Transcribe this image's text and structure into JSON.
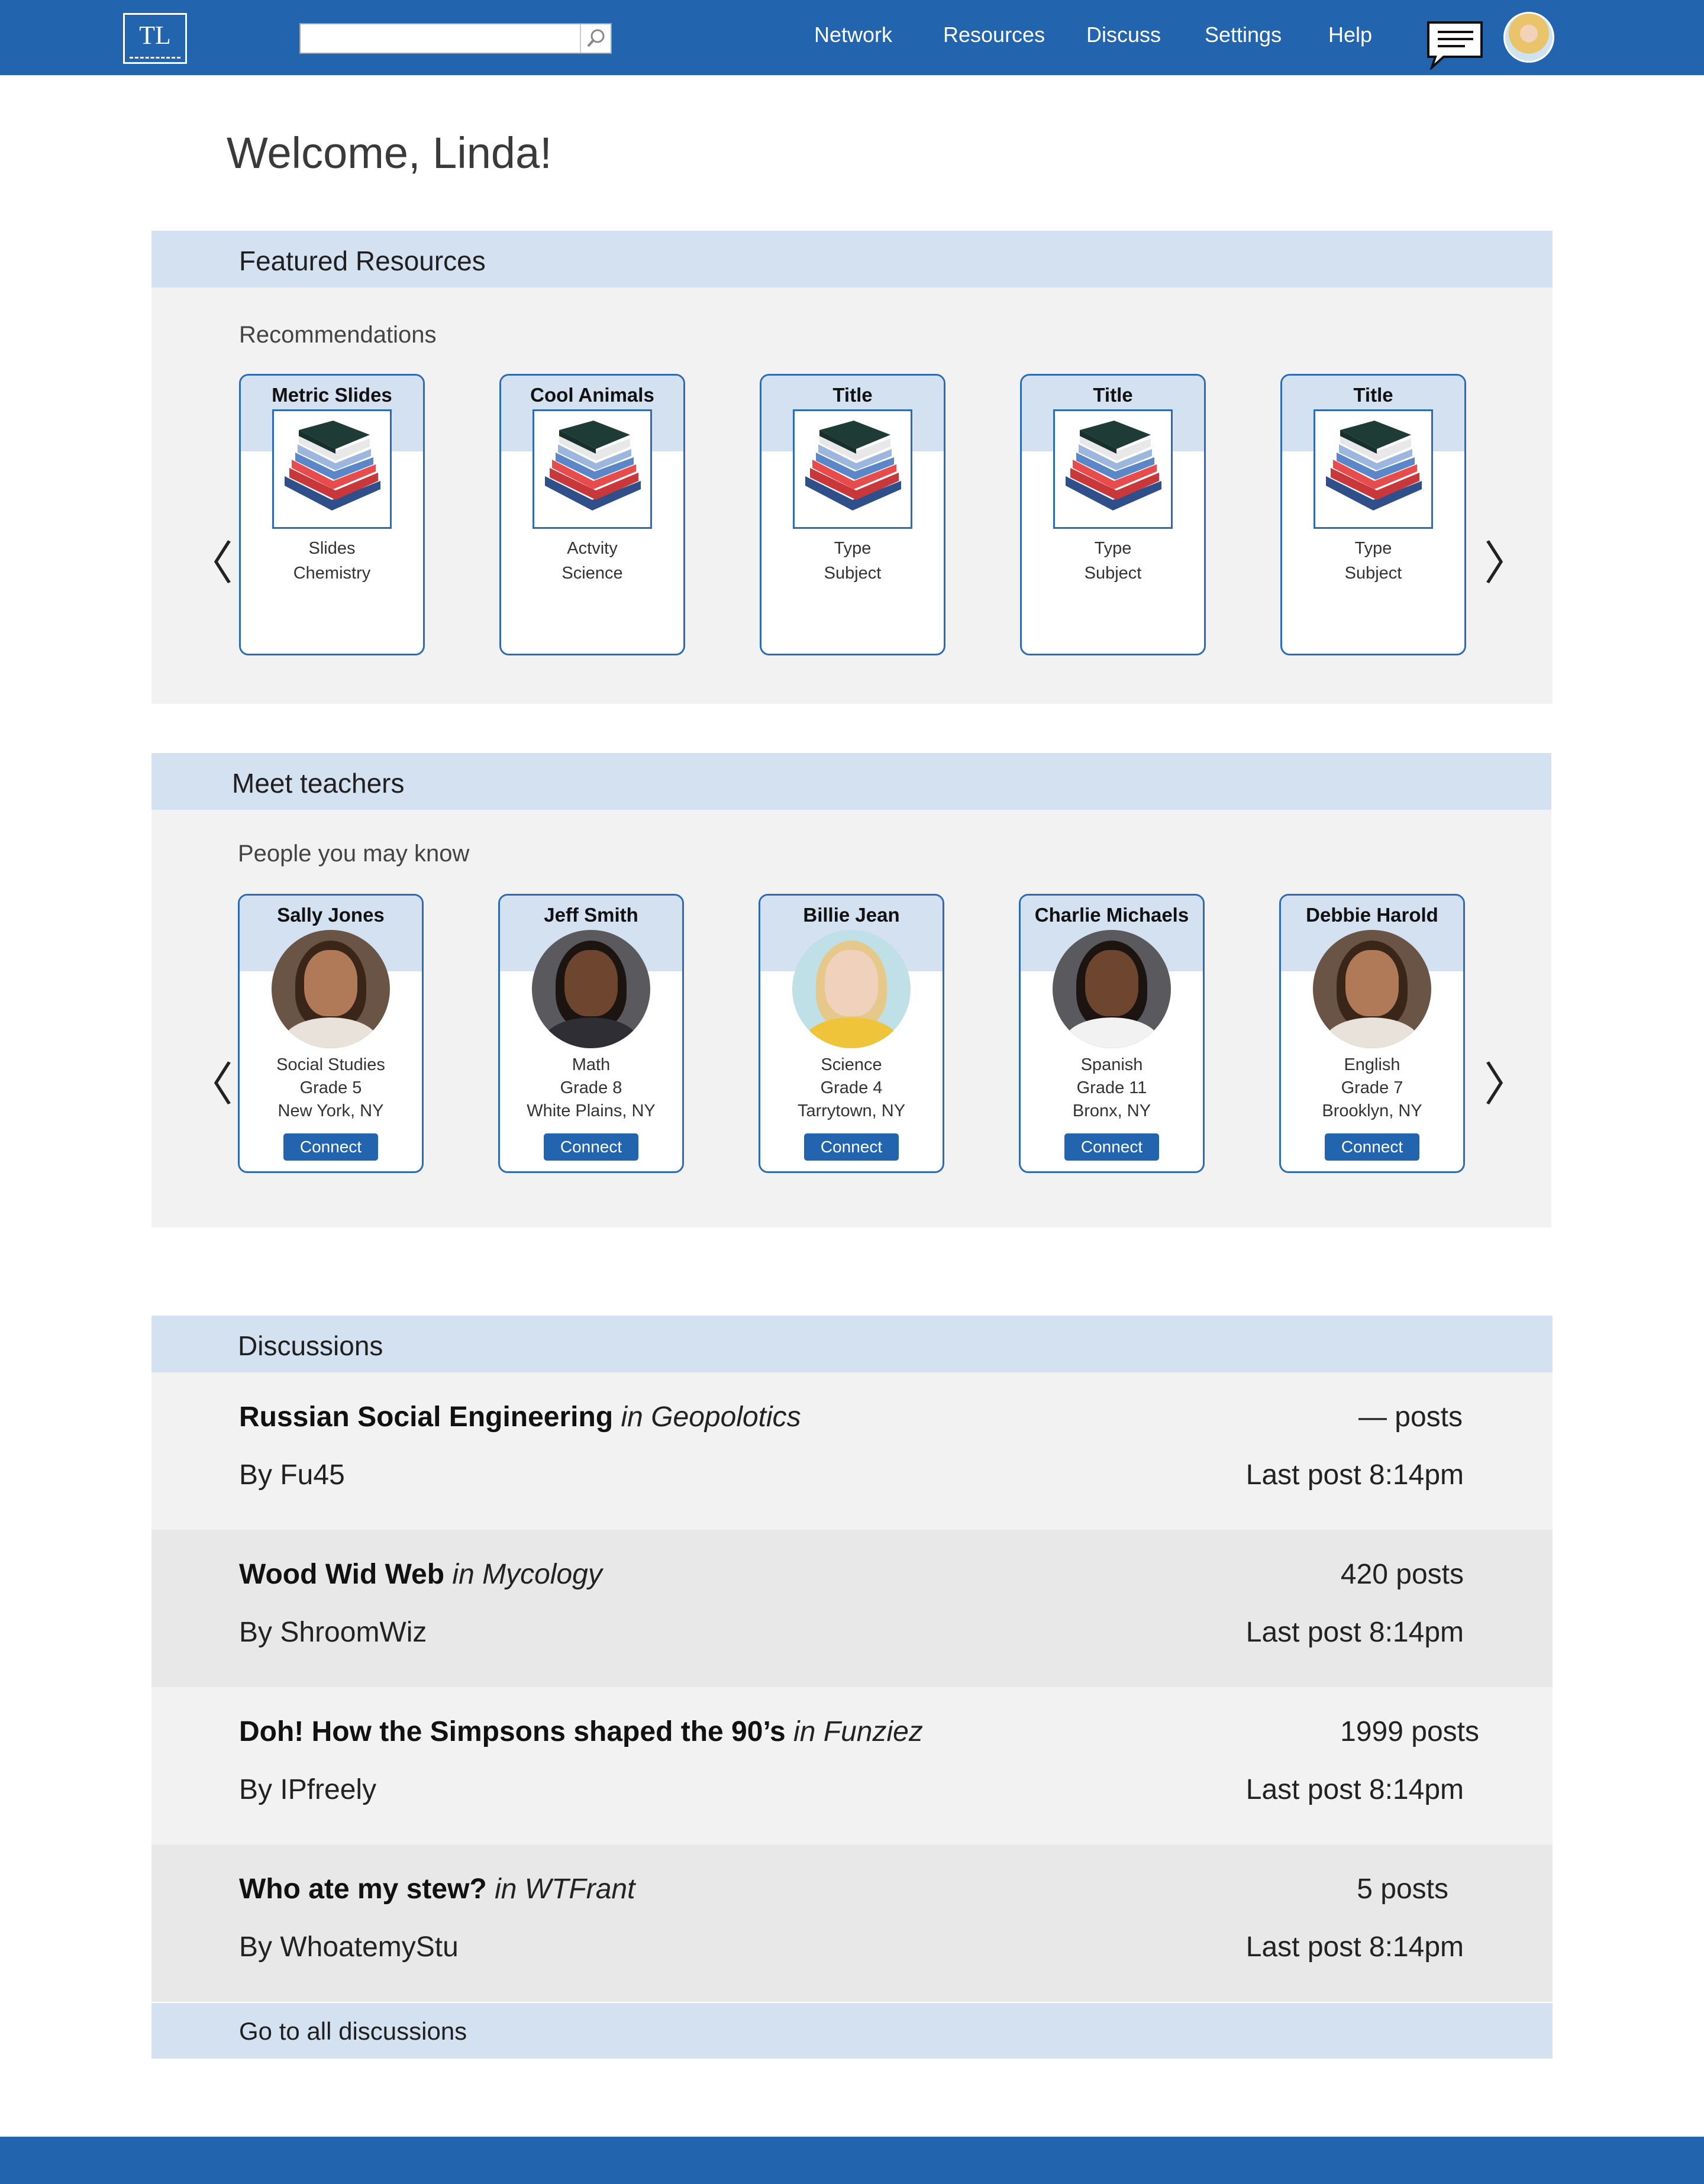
{
  "header": {
    "logo_text": "TL",
    "search_placeholder": "",
    "nav": [
      "Network",
      "Resources",
      "Discuss",
      "Settings",
      "Help"
    ],
    "brand_color": "#2264ae"
  },
  "welcome": "Welcome, Linda!",
  "featured": {
    "title": "Featured Resources",
    "subtitle": "Recommendations",
    "items": [
      {
        "title": "Metric Slides",
        "line1": "Slides",
        "line2": "Chemistry"
      },
      {
        "title": "Cool Animals",
        "line1": "Actvity",
        "line2": "Science"
      },
      {
        "title": "Title",
        "line1": "Type",
        "line2": "Subject"
      },
      {
        "title": "Title",
        "line1": "Type",
        "line2": "Subject"
      },
      {
        "title": "Title",
        "line1": "Type",
        "line2": "Subject"
      }
    ]
  },
  "teachers": {
    "title": "Meet teachers",
    "subtitle": "People you may know",
    "connect_label": "Connect",
    "items": [
      {
        "name": "Sally Jones",
        "subject": "Social Studies",
        "grade": "Grade 5",
        "location": "New York, NY"
      },
      {
        "name": "Jeff Smith",
        "subject": "Math",
        "grade": "Grade 8",
        "location": "White Plains, NY"
      },
      {
        "name": "Billie Jean",
        "subject": "Science",
        "grade": "Grade 4",
        "location": "Tarrytown, NY"
      },
      {
        "name": "Charlie Michaels",
        "subject": "Spanish",
        "grade": "Grade 11",
        "location": "Bronx, NY"
      },
      {
        "name": "Debbie Harold",
        "subject": "English",
        "grade": "Grade 7",
        "location": "Brooklyn, NY"
      }
    ]
  },
  "discussions": {
    "title": "Discussions",
    "footer_link": "Go to all discussions",
    "items": [
      {
        "title": "Russian Social Engineering",
        "category": "in Geopolotics",
        "by": "By Fu45",
        "posts": "— posts",
        "last_post": "Last post 8:14pm"
      },
      {
        "title": "Wood Wid Web",
        "category": "in Mycology",
        "by": "By ShroomWiz",
        "posts": "420 posts",
        "last_post": "Last post 8:14pm"
      },
      {
        "title": "Doh! How the Simpsons shaped the 90’s",
        "category": "in Funziez",
        "by": "By IPfreely",
        "posts": "1999 posts",
        "last_post": "Last post 8:14pm"
      },
      {
        "title": "Who ate my stew?",
        "category": "in WTFrant",
        "by": "By WhoatemyStu",
        "posts": "5 posts",
        "last_post": "Last post 8:14pm"
      }
    ]
  }
}
